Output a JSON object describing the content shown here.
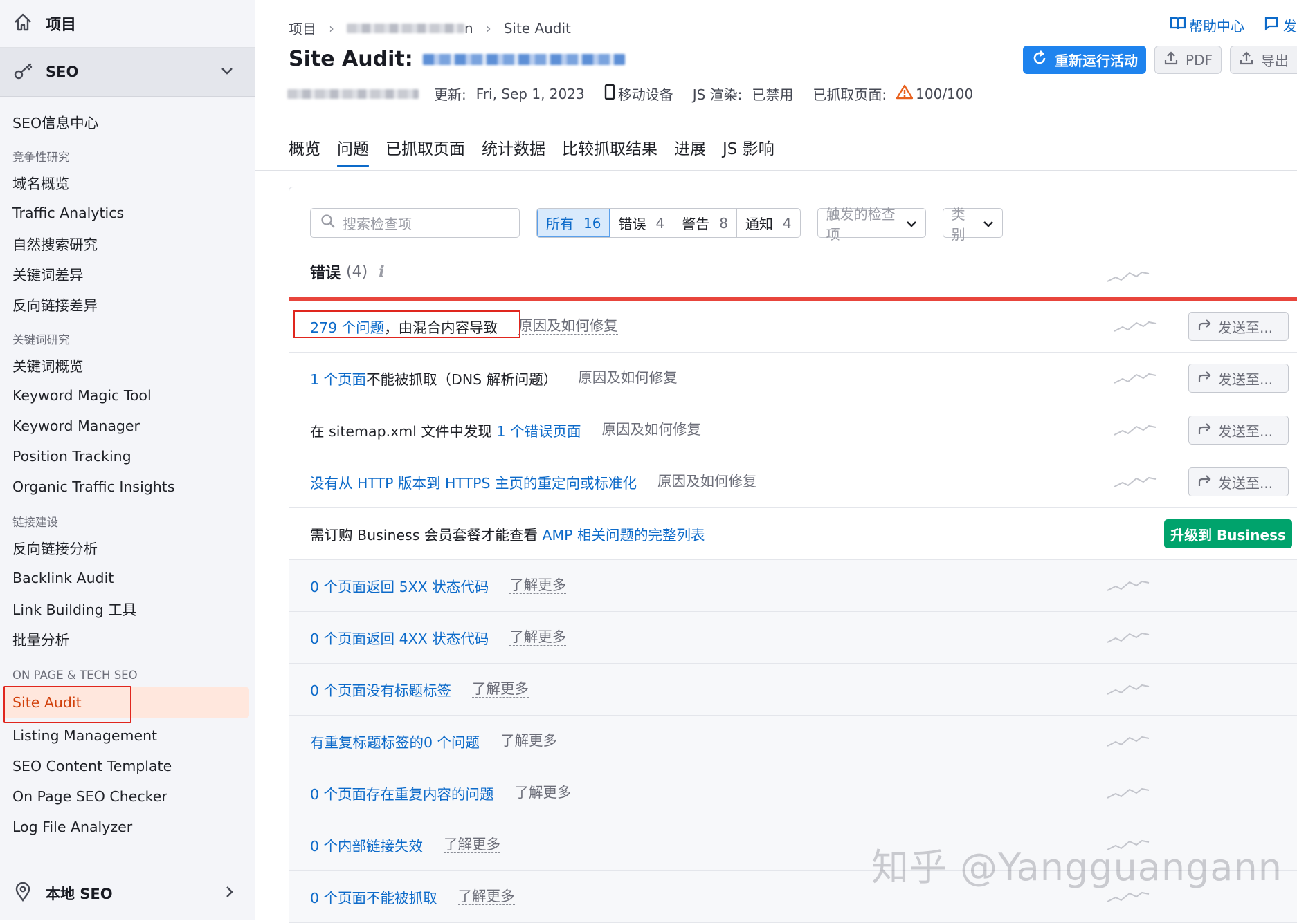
{
  "sidebar": {
    "projects_label": "项目",
    "seo_label": "SEO",
    "items": [
      {
        "type": "item",
        "label": "SEO信息中心"
      },
      {
        "type": "section",
        "label": "竞争性研究"
      },
      {
        "type": "item",
        "label": "域名概览"
      },
      {
        "type": "item",
        "label": "Traffic Analytics"
      },
      {
        "type": "item",
        "label": "自然搜索研究"
      },
      {
        "type": "item",
        "label": "关键词差异"
      },
      {
        "type": "item",
        "label": "反向链接差异"
      },
      {
        "type": "section",
        "label": "关键词研究"
      },
      {
        "type": "item",
        "label": "关键词概览"
      },
      {
        "type": "item",
        "label": "Keyword Magic Tool"
      },
      {
        "type": "item",
        "label": "Keyword Manager"
      },
      {
        "type": "item",
        "label": "Position Tracking"
      },
      {
        "type": "item",
        "label": "Organic Traffic Insights"
      },
      {
        "type": "section",
        "label": "链接建设"
      },
      {
        "type": "item",
        "label": "反向链接分析"
      },
      {
        "type": "item",
        "label": "Backlink Audit"
      },
      {
        "type": "item",
        "label": "Link Building 工具"
      },
      {
        "type": "item",
        "label": "批量分析"
      },
      {
        "type": "section",
        "label": "ON PAGE & TECH SEO"
      },
      {
        "type": "item",
        "label": "Site Audit",
        "active": true
      },
      {
        "type": "item",
        "label": "Listing Management"
      },
      {
        "type": "item",
        "label": "SEO Content Template"
      },
      {
        "type": "item",
        "label": "On Page SEO Checker"
      },
      {
        "type": "item",
        "label": "Log File Analyzer"
      }
    ],
    "local_seo_label": "本地 SEO"
  },
  "header": {
    "breadcrumb_root": "项目",
    "breadcrumb_mid_tail": "n",
    "breadcrumb_current": "Site Audit",
    "title_prefix": "Site Audit:",
    "updated_label": "更新:",
    "updated_value": "Fri, Sep 1, 2023",
    "device_label": "移动设备",
    "js_label": "JS 渲染:",
    "js_value": "已禁用",
    "crawled_label": "已抓取页面:",
    "crawled_value": "100/100",
    "help_label": "帮助中心",
    "feedback_label": "发",
    "rerun_label": "重新运行活动",
    "pdf_label": "PDF",
    "export_label": "导出"
  },
  "tabs": [
    "概览",
    "问题",
    "已抓取页面",
    "统计数据",
    "比较抓取结果",
    "进展",
    "JS 影响"
  ],
  "active_tab": 1,
  "filters": {
    "search_placeholder": "搜索检查项",
    "segments": [
      {
        "label": "所有",
        "count": "16",
        "active": true
      },
      {
        "label": "错误",
        "count": "4"
      },
      {
        "label": "警告",
        "count": "8"
      },
      {
        "label": "通知",
        "count": "4"
      }
    ],
    "triggered_label": "触发的检查项",
    "category_label": "类别"
  },
  "errors_section": {
    "title": "错误",
    "count": "(4)",
    "info": "i"
  },
  "issues": [
    {
      "parts": [
        {
          "t": "279 个问题",
          "link": true
        },
        {
          "t": "，由混合内容导致"
        }
      ],
      "why": "原因及如何修复",
      "send": "发送至...",
      "highlight": true
    },
    {
      "parts": [
        {
          "t": "1 个页面",
          "link": true
        },
        {
          "t": "不能被抓取（DNS 解析问题）"
        }
      ],
      "why": "原因及如何修复",
      "send": "发送至..."
    },
    {
      "parts": [
        {
          "t": "在 sitemap.xml 文件中发现 "
        },
        {
          "t": "1 个错误页面",
          "link": true
        }
      ],
      "why": "原因及如何修复",
      "send": "发送至..."
    },
    {
      "parts": [
        {
          "t": "没有从 HTTP 版本到 HTTPS 主页的重定向或标准化",
          "link": true
        }
      ],
      "why": "原因及如何修复",
      "send": "发送至..."
    },
    {
      "parts": [
        {
          "t": "需订购 Business 会员套餐才能查看 "
        },
        {
          "t": "AMP 相关问题的完整列表",
          "link": true
        }
      ],
      "upgrade": "升级到 Business"
    },
    {
      "parts": [
        {
          "t": "0 个页面返回 5XX 状态代码",
          "link": true
        }
      ],
      "why": "了解更多",
      "grey": true
    },
    {
      "parts": [
        {
          "t": "0 个页面返回 4XX 状态代码",
          "link": true
        }
      ],
      "why": "了解更多",
      "grey": true
    },
    {
      "parts": [
        {
          "t": "0 个页面没有标题标签",
          "link": true
        }
      ],
      "why": "了解更多",
      "grey": true
    },
    {
      "parts": [
        {
          "t": "有重复标题标签的0 个问题",
          "link": true
        }
      ],
      "why": "了解更多",
      "grey": true
    },
    {
      "parts": [
        {
          "t": "0 个页面存在重复内容的问题",
          "link": true
        }
      ],
      "why": "了解更多",
      "grey": true
    },
    {
      "parts": [
        {
          "t": "0 个内部链接失效",
          "link": true
        }
      ],
      "why": "了解更多",
      "grey": true
    },
    {
      "parts": [
        {
          "t": "0 个页面不能被抓取",
          "link": true
        }
      ],
      "why": "了解更多",
      "grey": true
    }
  ],
  "watermark": "知乎 @Yangguangann",
  "colors": {
    "link": "#0c6ac9",
    "primary": "#1e83ee",
    "error": "#e8453c",
    "upgrade": "#00a36c",
    "active_nav": "#d1410c"
  }
}
